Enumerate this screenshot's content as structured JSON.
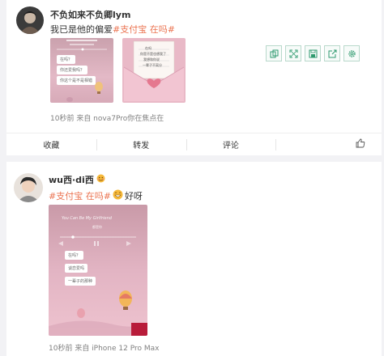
{
  "post1": {
    "username": "不负如来不负卿lym",
    "text_prefix": "我已是他的偏爱",
    "hashtag": "#支付宝 在吗#",
    "meta": "10秒前  来自 nova7Pro你在焦点在",
    "images": [
      {
        "name": "phone-chat-screenshot",
        "chat": [
          "在吗？",
          "你还爱我吗？",
          "你这个是不是相错"
        ]
      },
      {
        "name": "love-letter-envelope",
        "letter": [
          "在吗",
          "你是不是也想我了",
          "我想和你说",
          "一辈子不离分"
        ]
      }
    ],
    "toolbar": [
      {
        "icon": "copy-icon"
      },
      {
        "icon": "expand-icon"
      },
      {
        "icon": "save-icon"
      },
      {
        "icon": "share-icon"
      },
      {
        "icon": "settings-icon"
      }
    ],
    "actions": {
      "collect": "收藏",
      "repost": "转发",
      "comment": "评论",
      "like_icon": "thumbs-up-icon"
    }
  },
  "post2": {
    "username": "wu西·di西",
    "badge_icon": "face-emoji-icon",
    "hashtag": "#支付宝 在吗#",
    "emoji_icon": "grin-emoji-icon",
    "text_suffix": "好呀",
    "meta": "10秒前  来自 iPhone 12 Pro Max",
    "image": {
      "song_title": "You Can Be My Girlfriend",
      "artist": "都是你",
      "chat": [
        "在吗？",
        "谈恋爱吗",
        "一辈子的那种"
      ]
    }
  },
  "colors": {
    "accent": "#eb7350",
    "meta": "#808080",
    "pink": "#e7b3c3"
  }
}
